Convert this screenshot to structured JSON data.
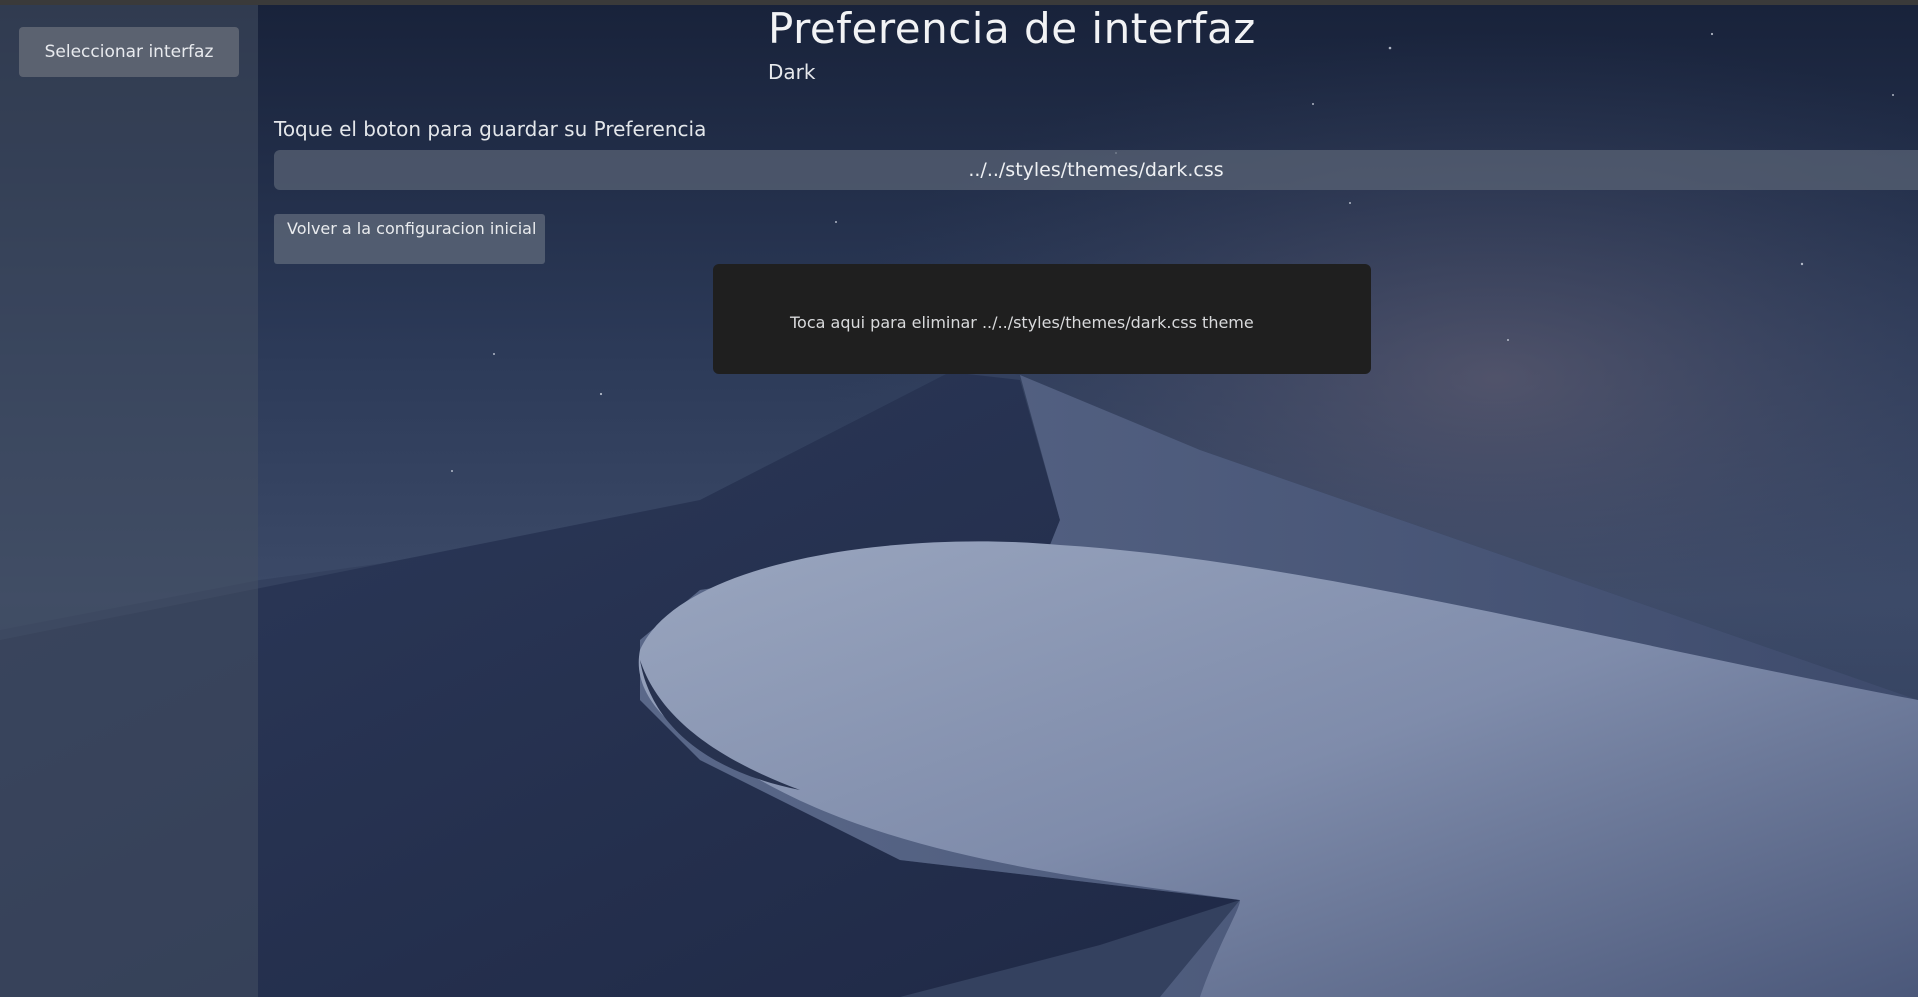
{
  "sidebar": {
    "select_button_label": "Seleccionar interfaz"
  },
  "main": {
    "title": "Preferencia de interfaz",
    "current_theme": "Dark",
    "instruction": "Toque el boton para guardar su Preferencia",
    "save_button_label": "../../styles/themes/dark.css",
    "reset_button_label": "Volver a la configuracion inicial",
    "delete_prompt": "Toca aqui para eliminar ../../styles/themes/dark.css theme"
  },
  "colors": {
    "sky_top": "#1c2640",
    "dune_light": "#aab3c8",
    "panel": "#1f1f1f"
  }
}
